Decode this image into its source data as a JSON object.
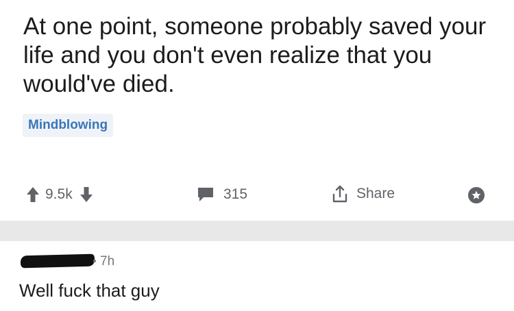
{
  "post": {
    "title": "At one point, someone probably saved your life and you don't even realize that you would've died.",
    "flair": "Mindblowing",
    "score": "9.5k",
    "comment_count": "315",
    "share_label": "Share"
  },
  "comment": {
    "time": "7h",
    "text": "Well fuck that guy"
  },
  "colors": {
    "flair_text": "#3a77b8",
    "flair_bg": "#eff3f8",
    "icon_gray": "#5f6368",
    "divider": "#e8e8e9"
  },
  "icons": [
    "upvote-icon",
    "downvote-icon",
    "comment-icon",
    "share-icon",
    "award-icon"
  ]
}
